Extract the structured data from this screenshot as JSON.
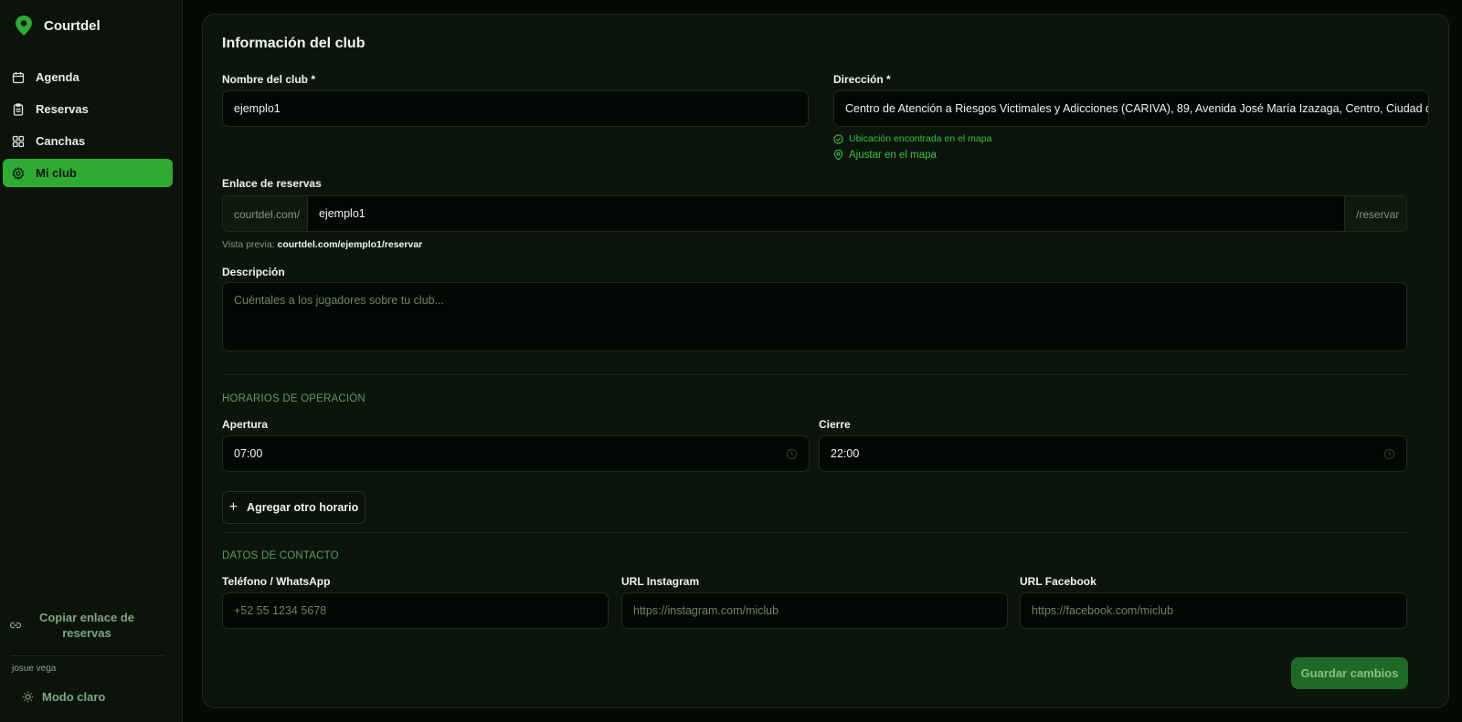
{
  "brand": {
    "name": "Courtdel"
  },
  "sidebar": {
    "items": [
      {
        "label": "Agenda",
        "icon": "calendar-icon"
      },
      {
        "label": "Reservas",
        "icon": "clipboard-icon"
      },
      {
        "label": "Canchas",
        "icon": "grid-icon"
      },
      {
        "label": "Mi club",
        "icon": "gear-icon",
        "active": true
      }
    ],
    "copy_link_label": "Copiar enlace de reservas",
    "user_name": "josue vega",
    "theme_toggle_label": "Modo claro"
  },
  "form": {
    "title": "Información del club",
    "club_name": {
      "label": "Nombre del club *",
      "value": "ejemplo1"
    },
    "address": {
      "label": "Dirección *",
      "value": "Centro de Atención a Riesgos Victimales y Adicciones (CARIVA), 89, Avenida José María Izazaga, Centro, Ciudad de México",
      "found_hint": "Ubicación encontrada en el mapa",
      "adjust_link": "Ajustar en el mapa"
    },
    "booking_link": {
      "label": "Enlace de reservas",
      "prefix": "courtdel.com/",
      "value": "ejemplo1",
      "suffix": "/reservar",
      "preview_label": "Vista previa:",
      "preview_value": "courtdel.com/ejemplo1/reservar"
    },
    "description": {
      "label": "Descripción",
      "placeholder": "Cuéntales a los jugadores sobre tu club..."
    }
  },
  "hours": {
    "section_title": "HORARIOS DE OPERACIÓN",
    "open": {
      "label": "Apertura",
      "value": "07:00"
    },
    "close": {
      "label": "Cierre",
      "value": "22:00"
    },
    "add_label": "Agregar otro horario"
  },
  "contact": {
    "section_title": "DATOS DE CONTACTO",
    "phone": {
      "label": "Teléfono / WhatsApp",
      "placeholder": "+52 55 1234 5678"
    },
    "instagram": {
      "label": "URL Instagram",
      "placeholder": "https://instagram.com/miclub"
    },
    "facebook": {
      "label": "URL Facebook",
      "placeholder": "https://facebook.com/miclub"
    }
  },
  "actions": {
    "save_label": "Guardar cambios"
  },
  "colors": {
    "accent": "#2eab32",
    "background": "#050a05",
    "card": "#0c150c",
    "hint": "#3cc043"
  }
}
